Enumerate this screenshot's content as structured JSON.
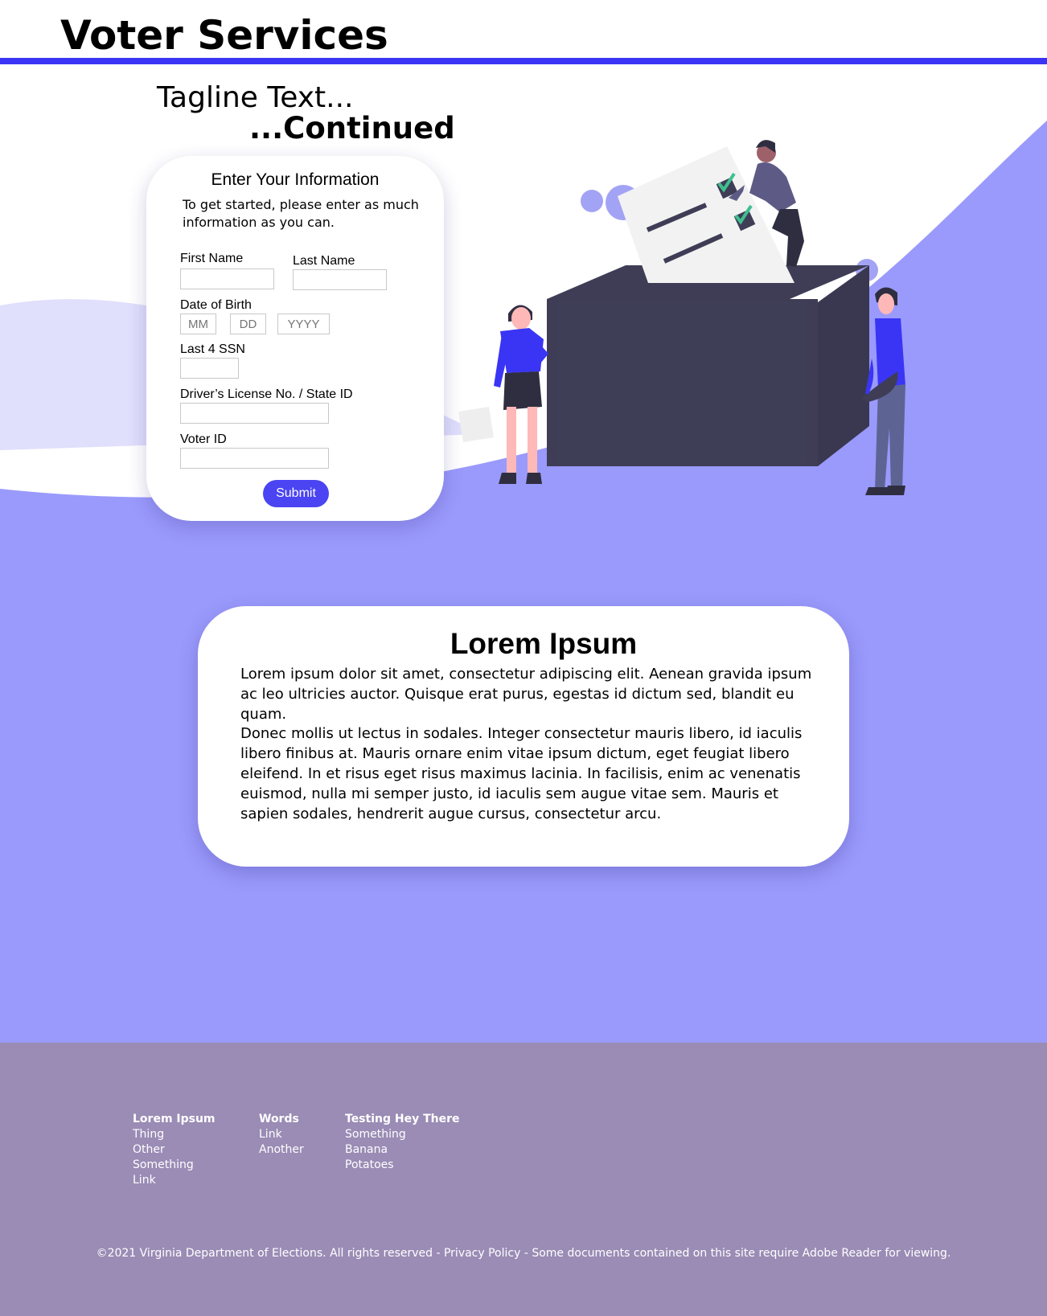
{
  "header": {
    "title": "Voter Services"
  },
  "tagline": {
    "line1": "Tagline Text...",
    "line2": "...Continued"
  },
  "form": {
    "title": "Enter Your Information",
    "intro": "To get started, please enter as much information as you can.",
    "first_name_label": "First Name",
    "last_name_label": "Last Name",
    "dob_label": "Date of Birth",
    "dob_mm_placeholder": "MM",
    "dob_dd_placeholder": "DD",
    "dob_yyyy_placeholder": "YYYY",
    "ssn_label": "Last 4 SSN",
    "license_label": "Driver’s License No. / State ID",
    "voter_id_label": "Voter ID",
    "submit_label": "Submit"
  },
  "content": {
    "title": "Lorem Ipsum",
    "paragraph1": "Lorem ipsum dolor sit amet, consectetur adipiscing elit. Aenean gravida ipsum ac leo ultricies auctor. Quisque erat purus, egestas id dictum sed, blandit eu quam.",
    "paragraph2": "Donec mollis ut lectus in sodales. Integer consectetur mauris libero, id iaculis libero finibus at. Mauris ornare enim vitae ipsum dictum, eget feugiat libero eleifend. In et risus eget risus maximus lacinia. In facilisis, enim ac venenatis euismod, nulla mi semper justo, id iaculis sem augue vitae sem. Mauris et sapien sodales, hendrerit augue cursus, consectetur arcu."
  },
  "footer": {
    "columns": [
      {
        "heading": "Lorem Ipsum",
        "links": [
          "Thing",
          "Other",
          "Something",
          "Link"
        ]
      },
      {
        "heading": "Words",
        "links": [
          "Link",
          "Another"
        ]
      },
      {
        "heading": "Testing Hey There",
        "links": [
          "Something",
          "Banana",
          "Potatoes"
        ]
      }
    ],
    "copyright": "©2021 Virginia Department of Elections. All rights reserved - Privacy Policy  - Some documents contained on this site require Adobe Reader for viewing."
  },
  "colors": {
    "accent": "#3a35f5",
    "background_purple": "#9a9afc",
    "light_wave": "#e0dffc",
    "footer": "#9a8cb5",
    "button": "#4a44f2"
  }
}
